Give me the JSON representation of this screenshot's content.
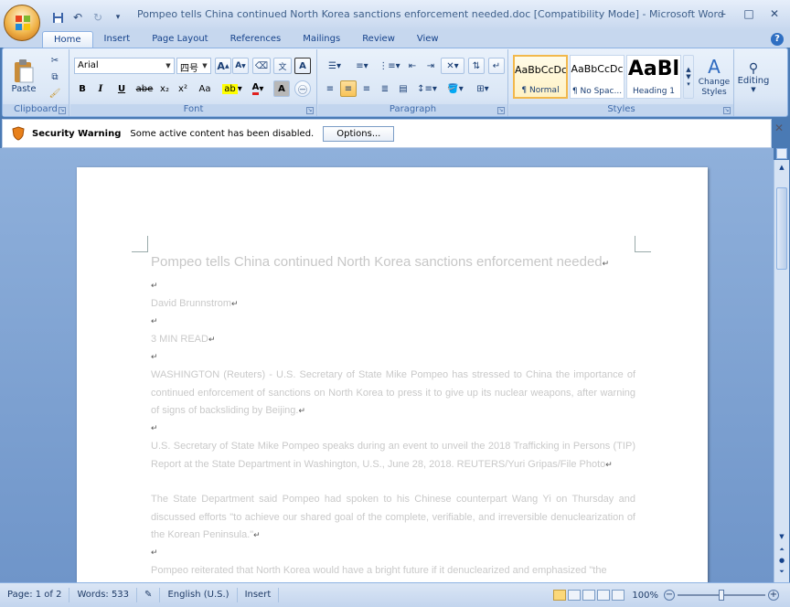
{
  "window": {
    "title": "Pompeo tells China continued North Korea sanctions enforcement needed.doc [Compatibility Mode] - Microsoft Word",
    "quick_access": [
      "save-icon",
      "undo-icon",
      "redo-icon",
      "customize-icon"
    ],
    "buttons": {
      "minimize": "–",
      "maximize": "□",
      "close": "✕"
    }
  },
  "ribbon": {
    "tabs": [
      "Home",
      "Insert",
      "Page Layout",
      "References",
      "Mailings",
      "Review",
      "View"
    ],
    "active_tab": "Home",
    "help": "?",
    "clipboard": {
      "label": "Clipboard",
      "paste": "Paste"
    },
    "font": {
      "label": "Font",
      "font_name": "Arial",
      "font_size": "四号",
      "grow": "A",
      "shrink": "A",
      "bold": "B",
      "italic": "I",
      "underline": "U",
      "strike": "abe",
      "subscript": "x₂",
      "superscript": "x²",
      "change_case": "Aa",
      "font_color": "A",
      "char_shading": "A"
    },
    "paragraph": {
      "label": "Paragraph"
    },
    "styles": {
      "label": "Styles",
      "tiles": [
        {
          "sample": "AaBbCcDc",
          "name": "¶ Normal"
        },
        {
          "sample": "AaBbCcDc",
          "name": "¶ No Spac..."
        },
        {
          "sample": "AaBl",
          "name": "Heading 1"
        }
      ],
      "change_styles": "Change Styles"
    },
    "editing": {
      "label": "Editing"
    }
  },
  "security_bar": {
    "title": "Security Warning",
    "message": "Some active content has been disabled.",
    "options_button": "Options..."
  },
  "document": {
    "heading": "Pompeo tells China continued North Korea sanctions enforcement needed",
    "author": "David Brunnstrom",
    "read_time": "3 MIN READ",
    "p1": "WASHINGTON (Reuters) - U.S. Secretary of State Mike Pompeo has stressed to China the importance of continued enforcement of sanctions on North Korea to press it to give up its nuclear weapons, after warning of signs of backsliding by Beijing.",
    "p2": "U.S. Secretary of State Mike Pompeo speaks during an event to unveil the 2018 Trafficking in Persons (TIP) Report at the State Department in Washington, U.S., June 28, 2018. REUTERS/Yuri Gripas/File Photo",
    "p3": "The State Department said Pompeo had spoken to his Chinese counterpart Wang Yi on Thursday and discussed efforts \"to achieve our shared goal of the complete, verifiable, and irreversible denuclearization of the Korean Peninsula.\"",
    "p4": "Pompeo reiterated that North Korea would have a bright future if it denuclearized and emphasized \"the",
    "paragraph_mark": "↵"
  },
  "status": {
    "page": "Page: 1 of 2",
    "words": "Words: 533",
    "language": "English (U.S.)",
    "mode": "Insert",
    "zoom": "100%",
    "zoom_level": 1.0
  },
  "colors": {
    "ribbon_bg": "#dbe7f6",
    "accent": "#15428b",
    "workspace": "#6f95c9",
    "security_shield": "#e8801a",
    "spell_squiggle": "#d43a3a"
  }
}
